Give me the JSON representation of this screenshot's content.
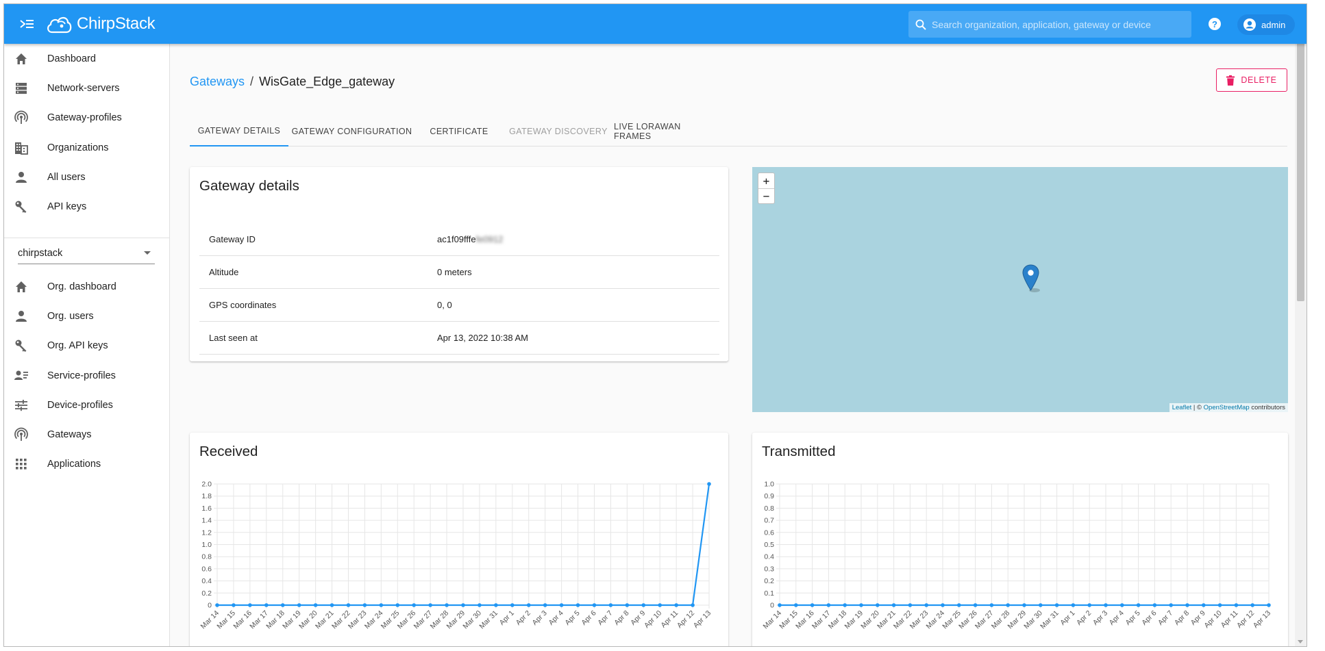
{
  "header": {
    "brand": "ChirpStack",
    "search_placeholder": "Search organization, application, gateway or device",
    "user": "admin"
  },
  "sidebar": {
    "top_items": [
      {
        "label": "Dashboard",
        "icon": "home-icon"
      },
      {
        "label": "Network-servers",
        "icon": "server-icon"
      },
      {
        "label": "Gateway-profiles",
        "icon": "antenna-icon"
      },
      {
        "label": "Organizations",
        "icon": "building-icon"
      },
      {
        "label": "All users",
        "icon": "person-icon"
      },
      {
        "label": "API keys",
        "icon": "key-icon"
      }
    ],
    "organization": "chirpstack",
    "org_items": [
      {
        "label": "Org. dashboard",
        "icon": "home-icon"
      },
      {
        "label": "Org. users",
        "icon": "person-icon"
      },
      {
        "label": "Org. API keys",
        "icon": "key-icon"
      },
      {
        "label": "Service-profiles",
        "icon": "account-details-icon"
      },
      {
        "label": "Device-profiles",
        "icon": "tune-icon"
      },
      {
        "label": "Gateways",
        "icon": "antenna-icon"
      },
      {
        "label": "Applications",
        "icon": "apps-grid-icon"
      }
    ]
  },
  "breadcrumb": {
    "parent": "Gateways",
    "separator": "/",
    "current": "WisGate_Edge_gateway"
  },
  "delete_label": "DELETE",
  "tabs": [
    {
      "label": "GATEWAY DETAILS",
      "state": "active"
    },
    {
      "label": "GATEWAY CONFIGURATION",
      "state": "normal"
    },
    {
      "label": "CERTIFICATE",
      "state": "normal"
    },
    {
      "label": "GATEWAY DISCOVERY",
      "state": "disabled"
    },
    {
      "label": "LIVE LORAWAN FRAMES",
      "state": "normal"
    }
  ],
  "details": {
    "title": "Gateway details",
    "rows": [
      {
        "key": "Gateway ID",
        "value": "ac1f09fffe",
        "value_hidden": "fe0912"
      },
      {
        "key": "Altitude",
        "value": "0 meters"
      },
      {
        "key": "GPS coordinates",
        "value": "0, 0"
      },
      {
        "key": "Last seen at",
        "value": "Apr 13, 2022 10:38 AM"
      }
    ]
  },
  "map": {
    "zoom_in": "+",
    "zoom_out": "−",
    "attribution_leaflet": "Leaflet",
    "attribution_sep": " | © ",
    "attribution_osm": "OpenStreetMap",
    "attribution_suffix": " contributors",
    "water_color": "#aad3df",
    "marker_color": "#2a81cb"
  },
  "colors": {
    "primary": "#2196f3",
    "danger": "#e91e63",
    "line": "#2196f3"
  },
  "chart_data": [
    {
      "type": "line",
      "title": "Received",
      "categories": [
        "Mar 14",
        "Mar 15",
        "Mar 16",
        "Mar 17",
        "Mar 18",
        "Mar 19",
        "Mar 20",
        "Mar 21",
        "Mar 22",
        "Mar 23",
        "Mar 24",
        "Mar 25",
        "Mar 26",
        "Mar 27",
        "Mar 28",
        "Mar 29",
        "Mar 30",
        "Mar 31",
        "Apr 1",
        "Apr 2",
        "Apr 3",
        "Apr 4",
        "Apr 5",
        "Apr 6",
        "Apr 7",
        "Apr 8",
        "Apr 9",
        "Apr 10",
        "Apr 11",
        "Apr 12",
        "Apr 13"
      ],
      "values": [
        0,
        0,
        0,
        0,
        0,
        0,
        0,
        0,
        0,
        0,
        0,
        0,
        0,
        0,
        0,
        0,
        0,
        0,
        0,
        0,
        0,
        0,
        0,
        0,
        0,
        0,
        0,
        0,
        0,
        0,
        2
      ],
      "ylim": [
        0,
        2.0
      ],
      "yticks": [
        "0",
        "0.2",
        "0.4",
        "0.6",
        "0.8",
        "1.0",
        "1.2",
        "1.4",
        "1.6",
        "1.8",
        "2.0"
      ],
      "grid": true,
      "legend": "none"
    },
    {
      "type": "line",
      "title": "Transmitted",
      "categories": [
        "Mar 14",
        "Mar 15",
        "Mar 16",
        "Mar 17",
        "Mar 18",
        "Mar 19",
        "Mar 20",
        "Mar 21",
        "Mar 22",
        "Mar 23",
        "Mar 24",
        "Mar 25",
        "Mar 26",
        "Mar 27",
        "Mar 28",
        "Mar 29",
        "Mar 30",
        "Mar 31",
        "Apr 1",
        "Apr 2",
        "Apr 3",
        "Apr 4",
        "Apr 5",
        "Apr 6",
        "Apr 7",
        "Apr 8",
        "Apr 9",
        "Apr 10",
        "Apr 11",
        "Apr 12",
        "Apr 13"
      ],
      "values": [
        0,
        0,
        0,
        0,
        0,
        0,
        0,
        0,
        0,
        0,
        0,
        0,
        0,
        0,
        0,
        0,
        0,
        0,
        0,
        0,
        0,
        0,
        0,
        0,
        0,
        0,
        0,
        0,
        0,
        0,
        0
      ],
      "ylim": [
        0,
        1.0
      ],
      "yticks": [
        "0",
        "0.1",
        "0.2",
        "0.3",
        "0.4",
        "0.5",
        "0.6",
        "0.7",
        "0.8",
        "0.9",
        "1.0"
      ],
      "grid": true,
      "legend": "none"
    }
  ]
}
